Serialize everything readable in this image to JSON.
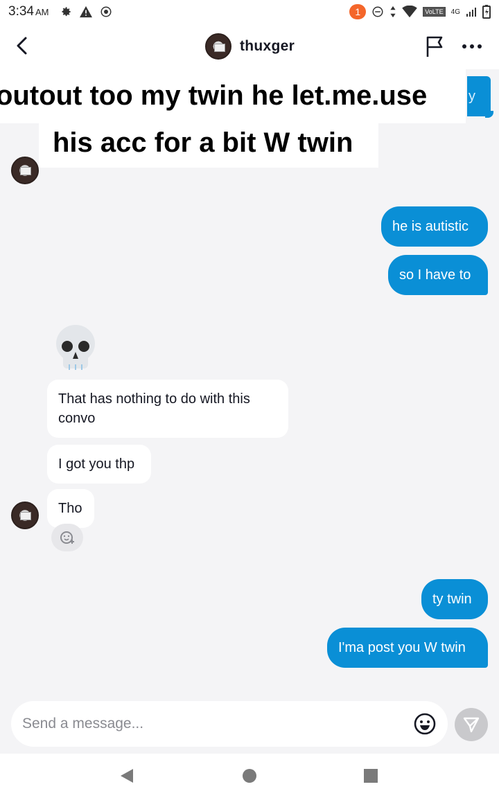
{
  "status_bar": {
    "time": "3:34",
    "ampm": "AM",
    "notification_count": "1",
    "volte": "VoLTE",
    "network": "4G"
  },
  "header": {
    "username": "thuxger"
  },
  "overlay_caption": {
    "line1": "outout too my twin he let.me.use",
    "line2": "his acc for a bit W twin",
    "hidden_bubble_fragment": "y"
  },
  "messages": {
    "out_1": "he is autistic",
    "out_2": "so I have to",
    "in_1": "That has nothing to do with this convo",
    "in_2": "I got you thp",
    "in_3": "Tho",
    "out_3": "ty twin",
    "out_4": "I'ma post you W twin"
  },
  "composer": {
    "placeholder": "Send a message..."
  },
  "colors": {
    "outgoing_bubble": "#0a8fd6",
    "incoming_bubble": "#ffffff",
    "background": "#f4f4f6"
  }
}
